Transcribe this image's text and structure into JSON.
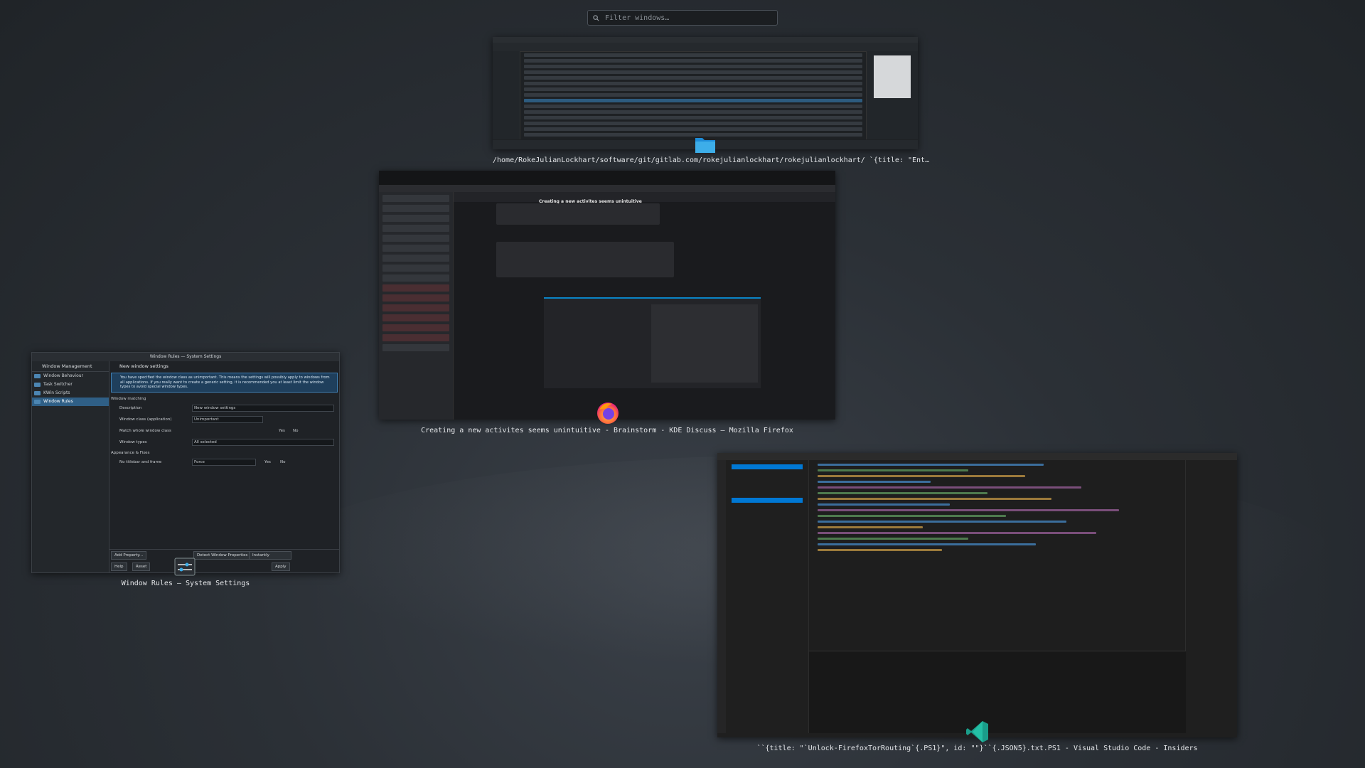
{
  "search": {
    "placeholder": "Filter windows…"
  },
  "windows": [
    {
      "caption": "/home/RokeJulianLockhart/software/git/gitlab.com/rokejulianlockhart/rokejulianlockhart/ `{title: \"Ent…",
      "icon": "folder-icon"
    },
    {
      "caption": "Creating a new activites seems unintuitive - Brainstorm - KDE Discuss — Mozilla Firefox",
      "icon": "firefox-icon"
    },
    {
      "caption": "Window Rules — System Settings",
      "icon": "settings-icon"
    },
    {
      "caption": "``{title: \"`Unlock-FirefoxTorRouting`{.PS1}\", id: \"\"}``{.JSON5}.txt.PS1 - Visual Studio Code - Insiders",
      "icon": "vscode-icon"
    }
  ],
  "settings_window": {
    "title": "Window Rules — System Settings",
    "sidebar_header": "Window Management",
    "sidebar_items": [
      "Window Behaviour",
      "Task Switcher",
      "KWin Scripts",
      "Window Rules"
    ],
    "page_title": "New window settings",
    "info": "You have specified the window class as unimportant. This means the settings will possibly apply to windows from all applications. If you really want to create a generic setting, it is recommended you at least limit the window types to avoid special window types.",
    "matching_header": "Window matching",
    "description_label": "Description",
    "description_value": "New window settings",
    "class_label": "Window class (application)",
    "class_value": "Unimportant",
    "whole_class_label": "Match whole window class",
    "yes": "Yes",
    "no": "No",
    "types_label": "Window types",
    "types_value": "All selected",
    "appearance_header": "Appearance & Fixes",
    "no_titlebar_label": "No titlebar and frame",
    "no_titlebar_value": "Force",
    "add_property": "Add Property...",
    "detect": "Detect Window Properties",
    "instantly": "Instantly",
    "help": "Help",
    "reset": "Reset",
    "apply": "Apply"
  },
  "firefox_window": {
    "page_title": "Creating a new activites seems unintuitive"
  },
  "colors": {
    "accent": "#3daee9",
    "selection": "#2f5f86",
    "firefox_orange": "#ff7139",
    "vscode_teal": "#24bfa5"
  }
}
